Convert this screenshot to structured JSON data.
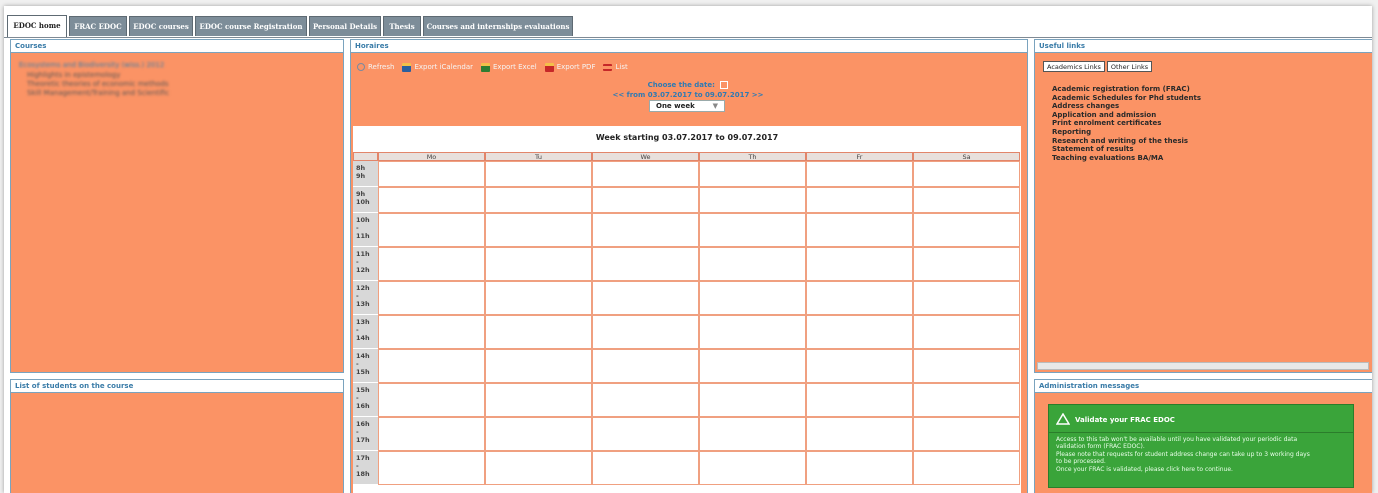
{
  "tabs": [
    {
      "label": "EDOC home",
      "active": true
    },
    {
      "label": "FRAC EDOC",
      "active": false
    },
    {
      "label": "EDOC courses",
      "active": false
    },
    {
      "label": "EDOC course Registration",
      "active": false
    },
    {
      "label": "Personal Details",
      "active": false
    },
    {
      "label": "Thesis",
      "active": false
    },
    {
      "label": "Courses and internships evaluations",
      "active": false
    }
  ],
  "courses": {
    "title": "Courses",
    "heading": "Ecosystems and Biodiversity (wiss.) 2012",
    "lines": [
      "Highlights in epistemology",
      "Theoretic theories of economic methods",
      "Skill Management/Training and Scientific"
    ]
  },
  "students": {
    "title": "List of students on the course"
  },
  "horaires": {
    "title": "Horaires",
    "toolbar": [
      {
        "label": "Refresh",
        "icon": "refresh-icon",
        "color": "#7a8aa0"
      },
      {
        "label": "Export iCalendar",
        "icon": "ical-icon",
        "color": "#2b5f9e"
      },
      {
        "label": "Export Excel",
        "icon": "excel-icon",
        "color": "#2e7d32"
      },
      {
        "label": "Export PDF",
        "icon": "pdf-icon",
        "color": "#c62828"
      },
      {
        "label": "List",
        "icon": "list-icon",
        "color": "#c62828"
      }
    ],
    "choose_date": "Choose the date:",
    "range_text": "<< from 03.07.2017 to 09.07.2017 >>",
    "period": "One week",
    "week_title": "Week starting 03.07.2017 to 09.07.2017",
    "days": [
      "Mo",
      "Tu",
      "We",
      "Th",
      "Fr",
      "Sa"
    ],
    "hours": [
      "8h - 9h",
      "9h - 10h",
      "10h - 11h",
      "11h - 12h",
      "12h - 13h",
      "13h - 14h",
      "14h - 15h",
      "15h - 16h",
      "16h - 17h",
      "17h - 18h"
    ]
  },
  "useful_links": {
    "title": "Useful links",
    "tabs": [
      "Academics Links",
      "Other Links"
    ],
    "links": [
      "Academic registration form (FRAC)",
      "Academic Schedules for Phd students",
      "Address changes",
      "Application and admission",
      "Print enrolment certificates",
      "Reporting",
      "Research and writing of the thesis",
      "Statement of results",
      "Teaching evaluations BA/MA"
    ]
  },
  "admin": {
    "title": "Administration messages",
    "validate_title": "Validate your FRAC EDOC",
    "lines": [
      "Access to this tab won't be available until you have validated your periodic data",
      "validation form (FRAC EDOC).",
      "Please note that requests for student address change can take up to 3 working days",
      "to be processed.",
      "Once your FRAC is validated, please click here to continue."
    ]
  },
  "colors": {
    "panel": "#fb9365",
    "accent": "#3a7ca8",
    "success": "#3aa43a"
  }
}
